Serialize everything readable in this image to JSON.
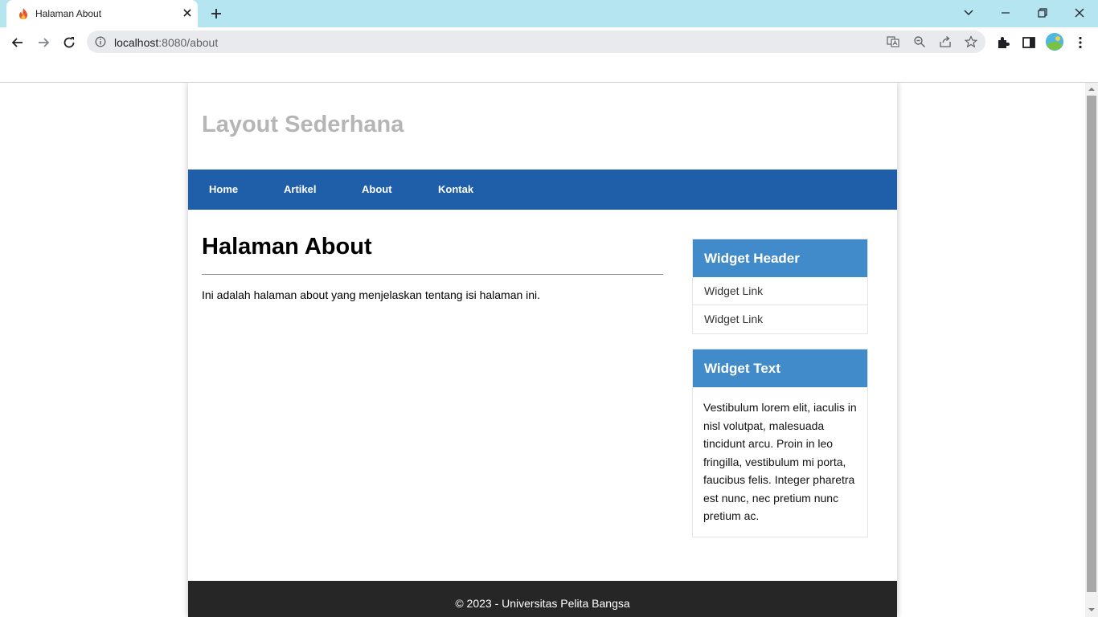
{
  "browser": {
    "tab_title": "Halaman About",
    "url_host": "localhost",
    "url_path": ":8080/about",
    "icons": [
      "flame-favicon-icon",
      "close-icon",
      "plus-icon",
      "chevron-down-icon",
      "minimize-icon",
      "restore-icon",
      "close-window-icon",
      "back-icon",
      "forward-icon",
      "reload-icon",
      "info-icon",
      "translate-icon",
      "zoom-icon",
      "share-icon",
      "star-icon",
      "extensions-icon",
      "side-panel-icon",
      "profile-avatar",
      "more-icon"
    ]
  },
  "site": {
    "title": "Layout Sederhana",
    "nav": [
      {
        "label": "Home"
      },
      {
        "label": "Artikel"
      },
      {
        "label": "About"
      },
      {
        "label": "Kontak"
      }
    ]
  },
  "main": {
    "heading": "Halaman About",
    "text": "Ini adalah halaman about yang menjelaskan tentang isi halaman ini."
  },
  "sidebar": {
    "widget1": {
      "header": "Widget Header",
      "links": [
        "Widget Link",
        "Widget Link"
      ]
    },
    "widget2": {
      "header": "Widget Text",
      "text": "Vestibulum lorem elit, iaculis in nisl volutpat, malesuada tincidunt arcu. Proin in leo fringilla, vestibulum mi porta, faucibus felis. Integer pharetra est nunc, nec pretium nunc pretium ac."
    }
  },
  "footer": {
    "text": "© 2023 - Universitas Pelita Bangsa"
  },
  "colors": {
    "tabbar": "#b6e5f2",
    "navbar": "#1f5faa",
    "widget_header": "#428bca",
    "footer": "#262626",
    "title_gray": "#b5b5b5"
  }
}
